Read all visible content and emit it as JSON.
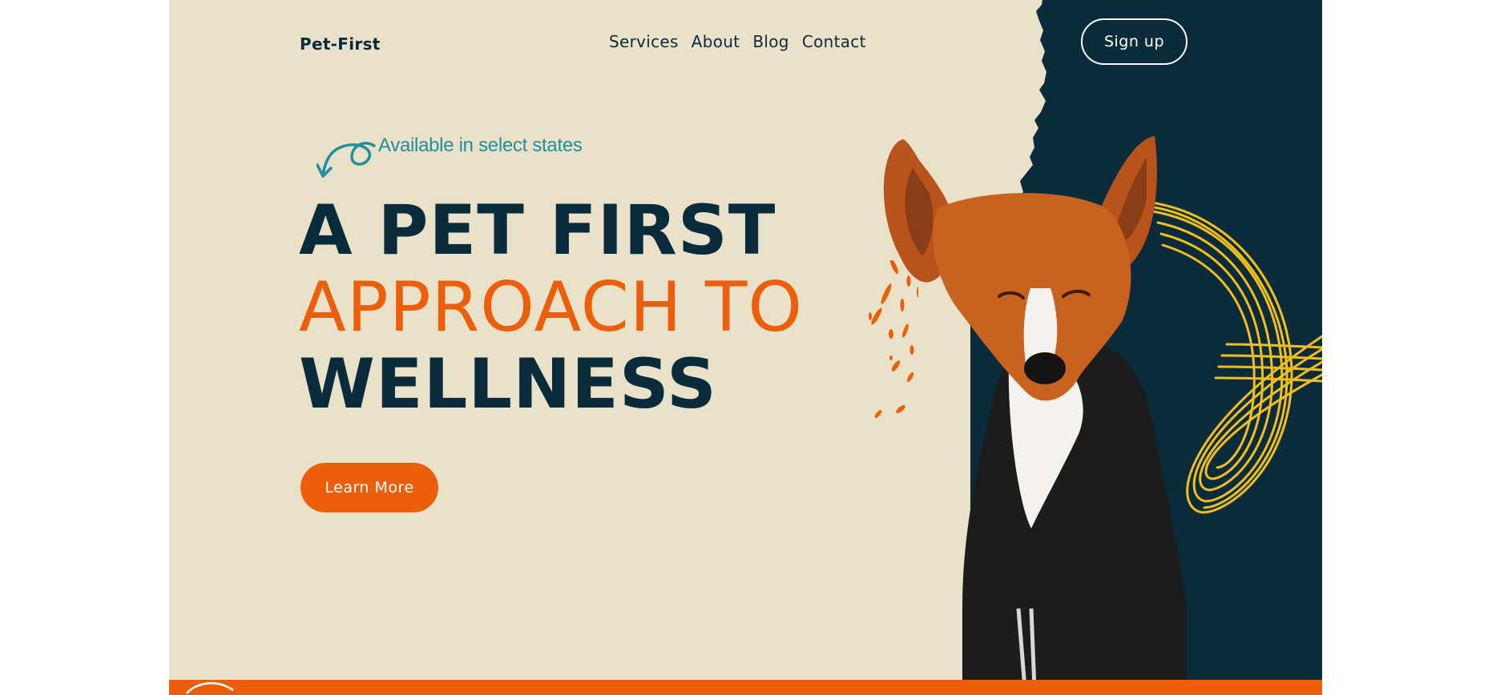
{
  "brand": {
    "logo": "Pet-First"
  },
  "nav": {
    "items": [
      {
        "label": "Services"
      },
      {
        "label": "About"
      },
      {
        "label": "Blog"
      },
      {
        "label": "Contact"
      }
    ]
  },
  "header": {
    "signup_label": "Sign up"
  },
  "hero": {
    "tagline": "Available in select states",
    "headline": {
      "line1": "A PET FIRST",
      "line2": "APPROACH TO",
      "line3": "WELLNESS"
    },
    "cta_label": "Learn More",
    "image_icon": "dog-in-hoodie-photo"
  },
  "colors": {
    "background": "#e9e1c8",
    "navy": "#0a2b3b",
    "orange": "#ec5e09",
    "teal": "#1f8fa1",
    "yellow": "#f2bf1a"
  }
}
